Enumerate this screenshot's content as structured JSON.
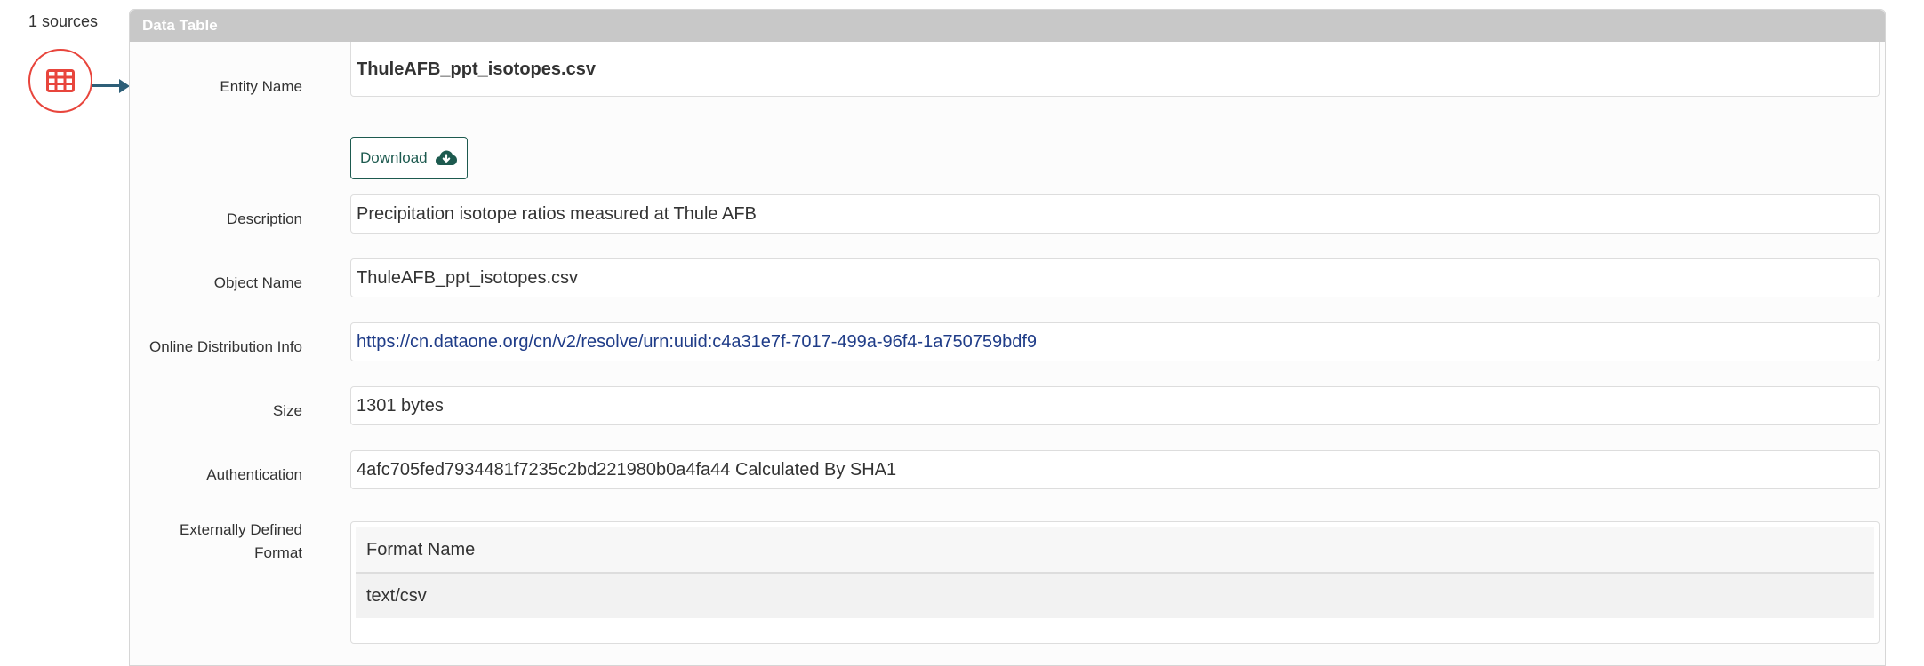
{
  "sources": {
    "count_label": "1 sources",
    "icon": "table-icon"
  },
  "panel": {
    "title": "Data Table"
  },
  "fields": {
    "entity_name": {
      "label": "Entity Name",
      "value": "ThuleAFB_ppt_isotopes.csv"
    },
    "download": {
      "label": "Download",
      "icon": "cloud-download-icon"
    },
    "description": {
      "label": "Description",
      "value": "Precipitation isotope ratios measured at Thule AFB"
    },
    "object_name": {
      "label": "Object Name",
      "value": "ThuleAFB_ppt_isotopes.csv"
    },
    "online_distribution": {
      "label": "Online Distribution Info",
      "value": "https://cn.dataone.org/cn/v2/resolve/urn:uuid:c4a31e7f-7017-499a-96f4-1a750759bdf9"
    },
    "size": {
      "label": "Size",
      "value": "1301 bytes"
    },
    "authentication": {
      "label": "Authentication",
      "value": "4afc705fed7934481f7235c2bd221980b0a4fa44 Calculated By SHA1"
    },
    "external_format": {
      "label_line1": "Externally Defined",
      "label_line2": "Format",
      "table": {
        "header": "Format Name",
        "rows": [
          "text/csv"
        ]
      }
    }
  },
  "colors": {
    "icon_red": "#e8453c",
    "connector": "#2e5f78",
    "header_bg": "#c8c8c8",
    "button_green": "#1d5a4f",
    "link_blue": "#1f3c88"
  }
}
